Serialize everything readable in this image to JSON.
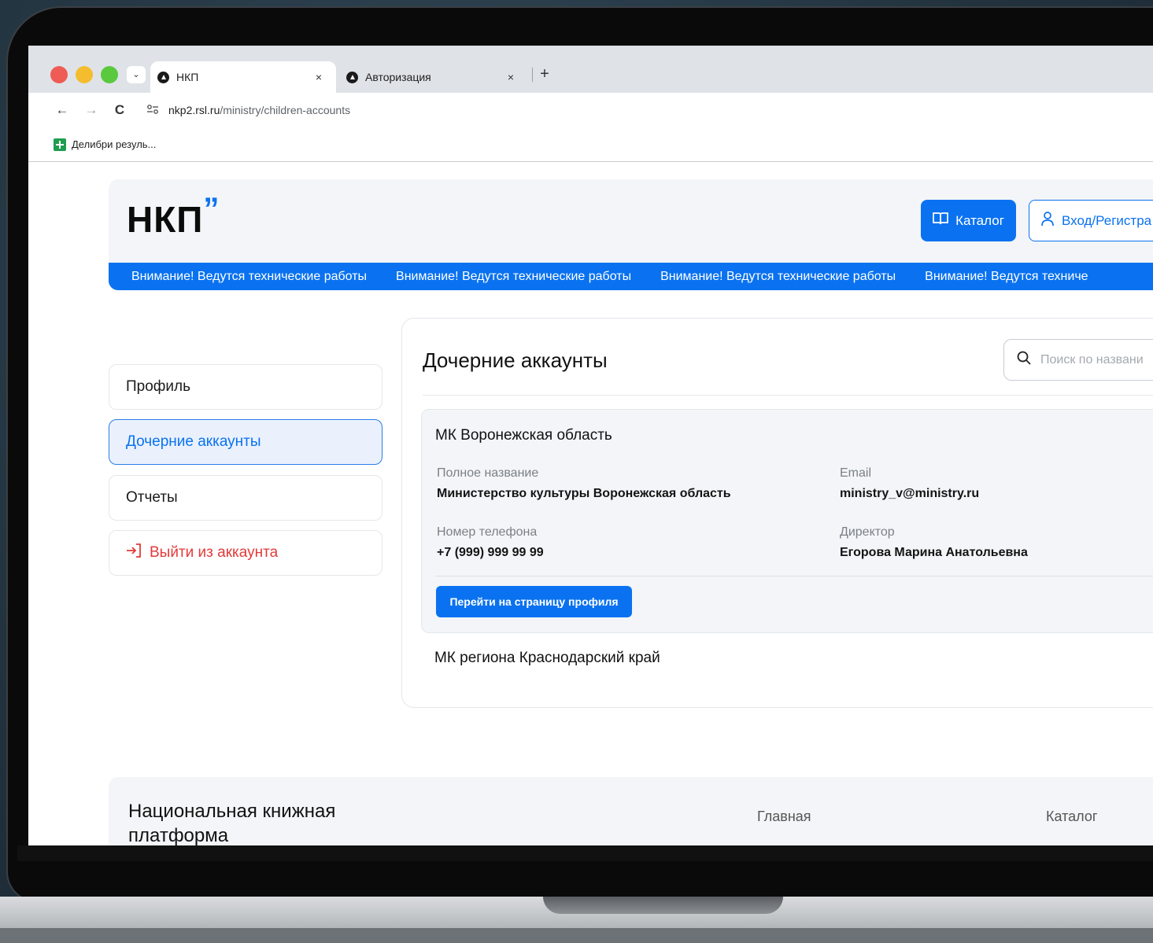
{
  "browser": {
    "tabs": [
      {
        "title": "НКП",
        "close": "×",
        "active": true
      },
      {
        "title": "Авторизация",
        "close": "×",
        "active": false
      }
    ],
    "new_tab": "+",
    "dropdown": "⌄",
    "nav": {
      "back": "←",
      "forward": "→",
      "reload": "C"
    },
    "url": {
      "host": "nkp2.rsl.ru",
      "path": "/ministry/children-accounts"
    },
    "bookmark": {
      "label": "Делибри резуль..."
    }
  },
  "header": {
    "logo": "НКП",
    "logo_mark": "”",
    "catalog_button": "Каталог",
    "login_button": "Вход/Регистра"
  },
  "ticker": {
    "items": [
      "Внимание! Ведутся технические работы",
      "Внимание! Ведутся технические работы",
      "Внимание! Ведутся технические работы",
      "Внимание! Ведутся техниче"
    ]
  },
  "sidebar": {
    "items": [
      {
        "label": "Профиль"
      },
      {
        "label": "Дочерние аккаунты"
      },
      {
        "label": "Отчеты"
      },
      {
        "label": "Выйти из аккаунта"
      }
    ]
  },
  "content": {
    "title": "Дочерние аккаунты",
    "search": {
      "placeholder": "Поиск по названи"
    },
    "accounts": [
      {
        "name": "МК Воронежская область",
        "full_name_label": "Полное название",
        "full_name": "Министерство культуры Воронежская область",
        "email_label": "Email",
        "email": "ministry_v@ministry.ru",
        "phone_label": "Номер телефона",
        "phone": "+7 (999) 999 99 99",
        "director_label": "Директор",
        "director": "Егорова Марина Анатольевна",
        "profile_button": "Перейти на страницу профиля"
      },
      {
        "name": "МК региона Краснодарский край"
      }
    ]
  },
  "footer": {
    "title": "Национальная книжная платформа",
    "links": [
      {
        "label": "Главная"
      },
      {
        "label": "Каталог"
      }
    ]
  },
  "colors": {
    "accent": "#0a72f0",
    "danger": "#e23a3a",
    "panel": "#f3f5f8"
  }
}
